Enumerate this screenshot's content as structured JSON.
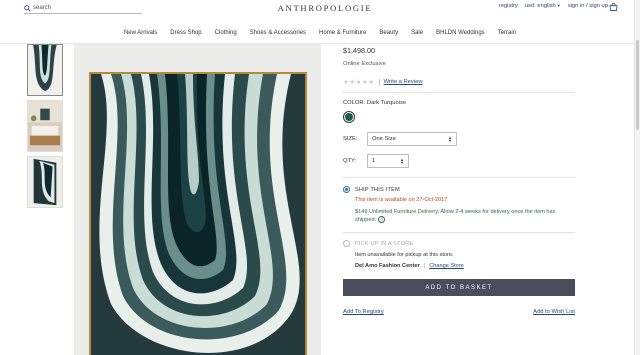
{
  "header": {
    "search_placeholder": "search",
    "logo": "ANTHROPOLOGIE",
    "util": {
      "registry": "registry",
      "currency": "usd: english",
      "sign_in": "sign in / sign up"
    },
    "nav": [
      "New Arrivals",
      "Dress Shop",
      "Clothing",
      "Shoes & Accessories",
      "Home & Furniture",
      "Beauty",
      "Sale",
      "BHLDN Weddings",
      "Terrain"
    ]
  },
  "product": {
    "price": "$1,498.00",
    "exclusive": "Online Exclusive",
    "write_review": "Write a Review",
    "color_label": "COLOR: Dark Turquoise",
    "swatch_color": "#1e5b52",
    "size_label": "SIZE:",
    "size_value": "One Size",
    "qty_label": "QTY:",
    "qty_value": "1"
  },
  "shipping": {
    "ship_title": "SHIP THIS ITEM",
    "availability": "This item is available on 27-Oct-2017",
    "delivery": "$149 Unlimited Furniture Delivery. Allow 2-4 weeks for delivery once the item has shipped.",
    "help": "?",
    "pickup_title": "PICK UP IN A STORE",
    "pickup_note": "Item unavailable for pickup at this store.",
    "store_name": "Del Amo Fashion Center",
    "store_sep": "|",
    "change_store": "Change Store"
  },
  "actions": {
    "add_to_basket": "ADD TO BASKET",
    "add_to_registry": "Add To Registry",
    "add_to_wishlist": "Add to Wish List"
  },
  "colors": {
    "link": "#1f4a7a",
    "availability": "#c2441a",
    "delivery": "#2b6e3a",
    "button": "#4a4d5c"
  }
}
